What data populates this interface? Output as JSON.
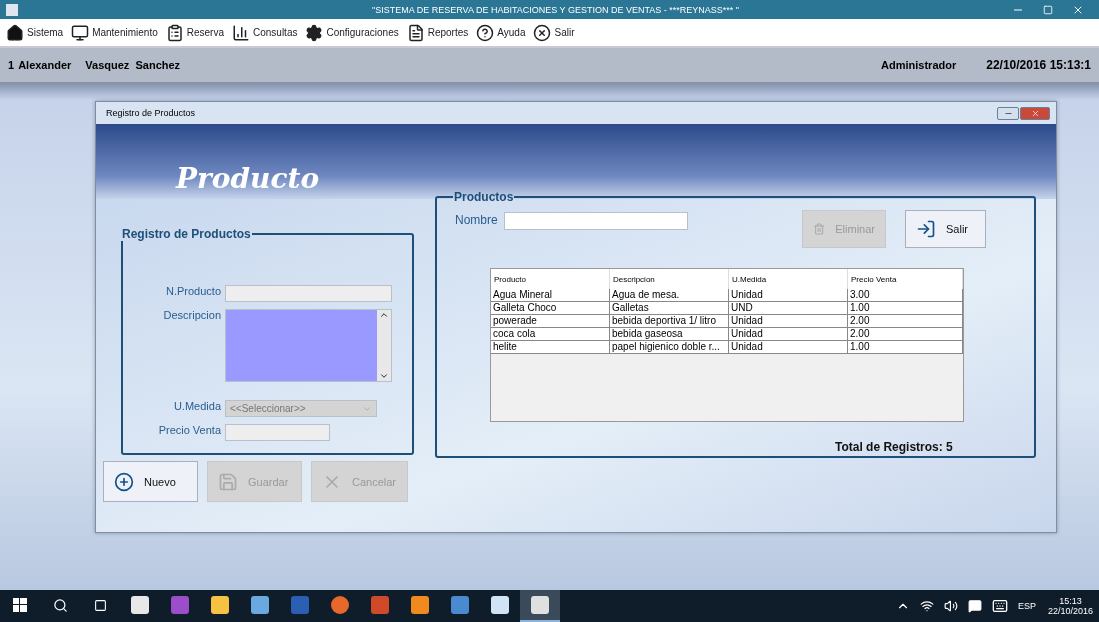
{
  "window": {
    "title": "\"SISTEMA DE RESERVA DE HABITACIONES Y GESTION DE VENTAS  - ***REYNASS*** \""
  },
  "menu": [
    {
      "label": "Sistema",
      "kind": "house"
    },
    {
      "label": "Mantenimiento",
      "kind": "monitor"
    },
    {
      "label": "Reserva",
      "kind": "list"
    },
    {
      "label": "Consultas",
      "kind": "chart"
    },
    {
      "label": "Configuraciones",
      "kind": "gears"
    },
    {
      "label": "Reportes",
      "kind": "document"
    },
    {
      "label": "Ayuda",
      "kind": "help"
    },
    {
      "label": "Salir",
      "kind": "close"
    }
  ],
  "user_bar": {
    "id": "1",
    "first_name": "Alexander",
    "last_names": "Vasquez  Sanchez",
    "role": "Administrador",
    "datetime": "22/10/2016 15:13:1"
  },
  "dialog": {
    "title": "Registro de Productos",
    "heading": "Producto",
    "form": {
      "title": "Registro de Productos",
      "fields": [
        {
          "label": "N.Producto",
          "kind": "text"
        },
        {
          "label": "Descripcion",
          "kind": "textarea"
        },
        {
          "label": "U.Medida",
          "kind": "combo",
          "value": "<<Seleccionar>>"
        },
        {
          "label": "Precio Venta",
          "kind": "short"
        }
      ]
    },
    "form_buttons": [
      {
        "label": "Nuevo",
        "kind": "new",
        "disabled": false
      },
      {
        "label": "Guardar",
        "kind": "save",
        "disabled": true
      },
      {
        "label": "Cancelar",
        "kind": "cancel",
        "disabled": true
      }
    ],
    "list": {
      "title": "Productos",
      "search_label": "Nombre",
      "buttons": [
        {
          "label": "Eliminar",
          "kind": "delete",
          "disabled": true
        },
        {
          "label": "Salir",
          "kind": "exit",
          "disabled": false
        }
      ],
      "table": {
        "columns": [
          "Producto",
          "Descripcion",
          "U.Medida",
          "Precio Venta"
        ],
        "rows": [
          [
            "Agua Mineral",
            "Agua de mesa.",
            "Unidad",
            "3.00"
          ],
          [
            "Galleta Choco",
            "Galletas",
            "UND",
            "1.00"
          ],
          [
            "powerade",
            "bebida deportiva 1/ litro",
            "Unidad",
            "2.00"
          ],
          [
            "coca cola",
            "bebida gaseosa",
            "Unidad",
            "2.00"
          ],
          [
            "helite",
            "papel higienico doble r...",
            "Unidad",
            "1.00"
          ]
        ]
      },
      "total": "Total de Registros: 5"
    }
  },
  "taskbar": {
    "apps": [
      {
        "selected": false
      },
      {
        "selected": false
      },
      {
        "selected": false
      },
      {
        "selected": false
      },
      {
        "selected": false
      },
      {
        "selected": false
      },
      {
        "selected": false
      },
      {
        "selected": false
      },
      {
        "selected": false
      },
      {
        "selected": false
      },
      {
        "selected": true
      }
    ],
    "language": "ESP",
    "time": "15:13",
    "date": "22/10/2016"
  }
}
